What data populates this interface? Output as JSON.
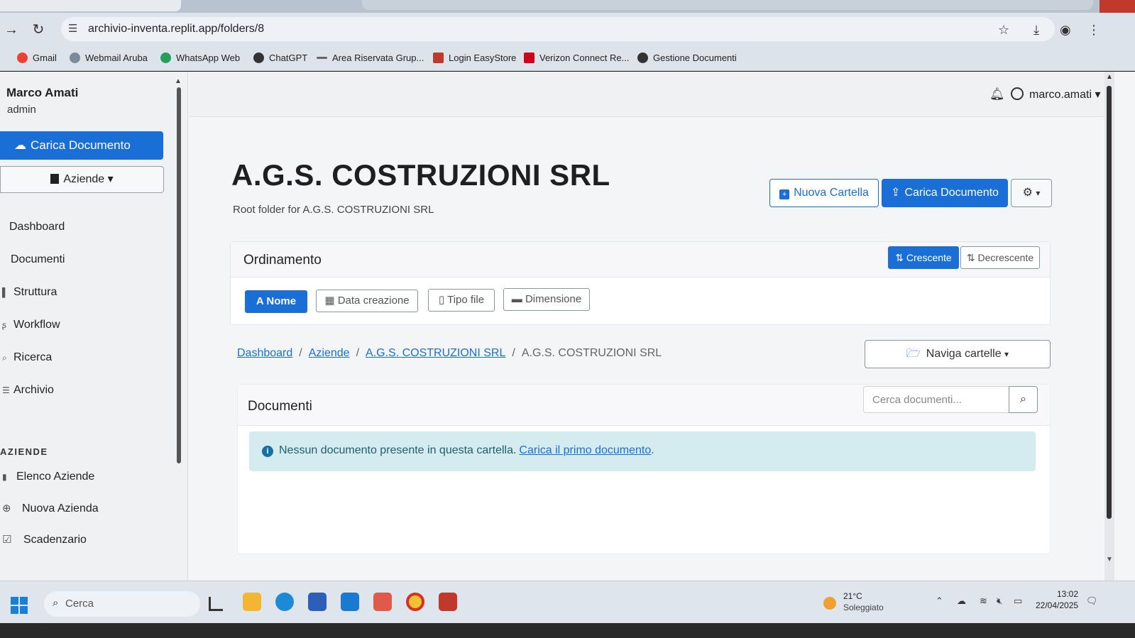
{
  "browser": {
    "url": "archivio-inventa.replit.app/folders/8",
    "bookmarks": [
      {
        "label": "Gmail",
        "color": "#ea4335"
      },
      {
        "label": "Webmail Aruba",
        "color": "#7d8a99"
      },
      {
        "label": "WhatsApp Web",
        "color": "#25a05a"
      },
      {
        "label": "ChatGPT",
        "color": "#333333"
      },
      {
        "label": "Area Riservata Grup...",
        "color": "#666666"
      },
      {
        "label": "Login EasyStore",
        "color": "#c0392b"
      },
      {
        "label": "Verizon Connect Re...",
        "color": "#d0021b"
      },
      {
        "label": "Gestione Documenti",
        "color": "#333333"
      }
    ]
  },
  "sidebar": {
    "user_name": "Marco Amati",
    "user_role": "admin",
    "upload_label": "Carica Documento",
    "aziende_label": "Aziende",
    "nav": [
      {
        "label": "Dashboard"
      },
      {
        "label": "Documenti"
      },
      {
        "label": "Struttura"
      },
      {
        "label": "Workflow"
      },
      {
        "label": "Ricerca"
      },
      {
        "label": "Archivio"
      }
    ],
    "section_title": "AZIENDE",
    "section_items": [
      {
        "label": "Elenco Aziende"
      },
      {
        "label": "Nuova Azienda"
      },
      {
        "label": "Scadenzario"
      }
    ]
  },
  "header": {
    "username": "marco.amati"
  },
  "main": {
    "title": "A.G.S. COSTRUZIONI SRL",
    "subtitle": "Root folder for A.G.S. COSTRUZIONI SRL",
    "new_folder_label": "Nuova Cartella",
    "upload_label": "Carica Documento",
    "sorting": {
      "title": "Ordinamento",
      "asc_label": "Crescente",
      "desc_label": "Decrescente",
      "fields": [
        {
          "label": "Nome",
          "active": true
        },
        {
          "label": "Data creazione",
          "active": false
        },
        {
          "label": "Tipo file",
          "active": false
        },
        {
          "label": "Dimensione",
          "active": false
        }
      ]
    },
    "breadcrumb": [
      "Dashboard",
      "Aziende",
      "A.G.S. COSTRUZIONI SRL",
      "A.G.S. COSTRUZIONI SRL"
    ],
    "navigate_label": "Naviga cartelle",
    "documents": {
      "title": "Documenti",
      "search_placeholder": "Cerca documenti...",
      "empty_text": "Nessun documento presente in questa cartella.",
      "empty_link": "Carica il primo documento",
      "empty_trailing": "."
    }
  },
  "taskbar": {
    "search_label": "Cerca",
    "weather_temp": "21°C",
    "weather_desc": "Soleggiato",
    "time": "13:02",
    "date": "22/04/2025"
  },
  "colors": {
    "accent": "#1a6fd6",
    "alert_bg": "#d4ecf0"
  }
}
